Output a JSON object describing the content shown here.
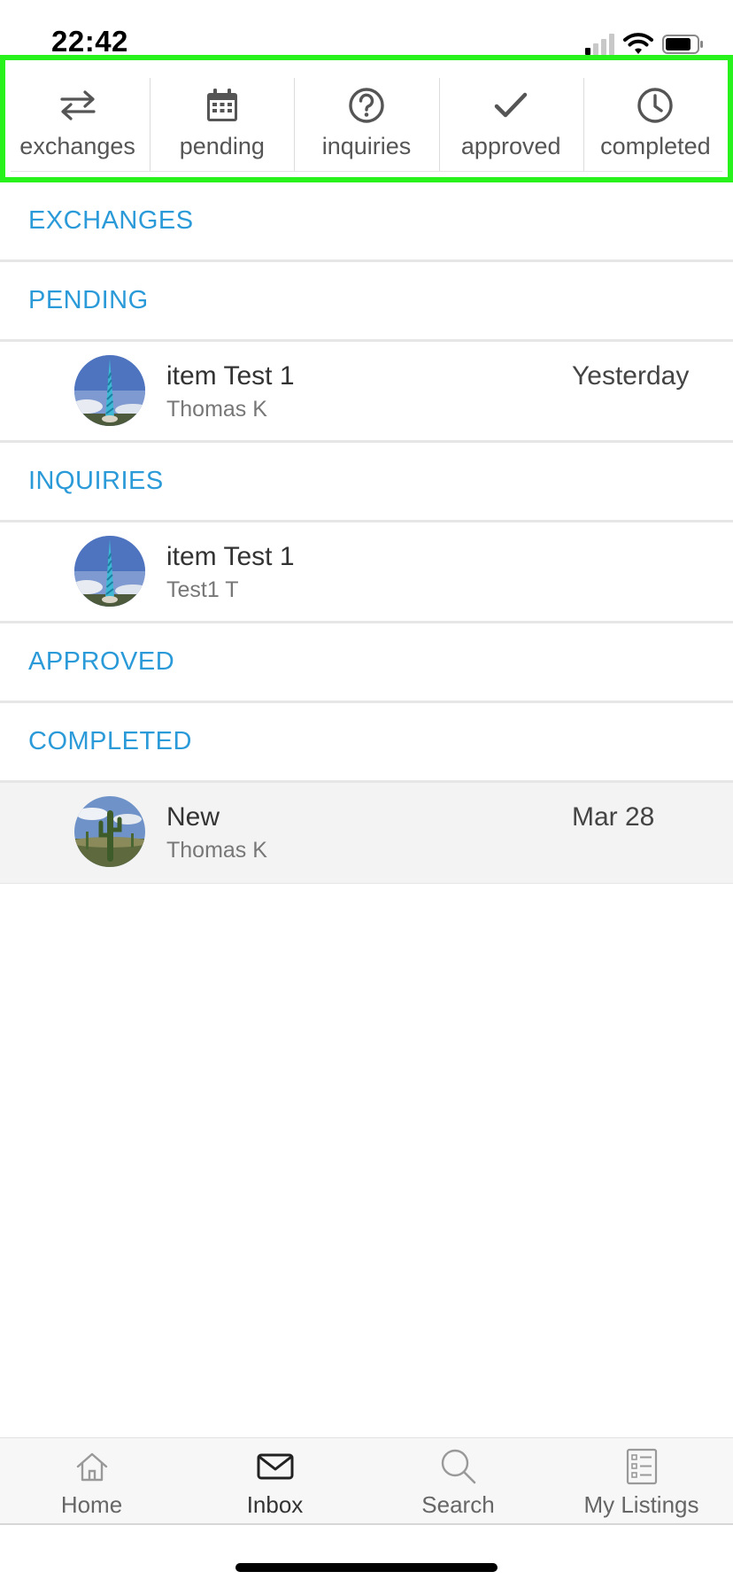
{
  "status_bar": {
    "time": "22:42"
  },
  "top_tabs": [
    {
      "label": "exchanges",
      "icon": "exchange-arrows-icon"
    },
    {
      "label": "pending",
      "icon": "calendar-icon"
    },
    {
      "label": "inquiries",
      "icon": "question-circle-icon"
    },
    {
      "label": "approved",
      "icon": "checkmark-icon"
    },
    {
      "label": "completed",
      "icon": "clock-icon"
    }
  ],
  "sections": {
    "exchanges": {
      "header": "EXCHANGES",
      "items": []
    },
    "pending": {
      "header": "PENDING",
      "items": [
        {
          "title": "item Test 1",
          "subtitle": "Thomas K",
          "date": "Yesterday",
          "thumbnail": "blue-spiral-tower"
        }
      ]
    },
    "inquiries": {
      "header": "INQUIRIES",
      "items": [
        {
          "title": "item Test 1",
          "subtitle": "Test1 T",
          "date": "",
          "thumbnail": "blue-spiral-tower"
        }
      ]
    },
    "approved": {
      "header": "APPROVED",
      "items": []
    },
    "completed": {
      "header": "COMPLETED",
      "items": [
        {
          "title": "New",
          "subtitle": "Thomas K",
          "date": "Mar 28",
          "thumbnail": "saguaro-cactus"
        }
      ]
    }
  },
  "bottom_nav": {
    "active": "Inbox",
    "items": [
      {
        "label": "Home",
        "icon": "home-icon"
      },
      {
        "label": "Inbox",
        "icon": "envelope-icon"
      },
      {
        "label": "Search",
        "icon": "search-icon"
      },
      {
        "label": "My Listings",
        "icon": "listings-icon"
      }
    ]
  },
  "colors": {
    "section_header": "#2b9ad8",
    "highlight_border": "#27f21b",
    "selected_row_bg": "#f3f3f3"
  }
}
